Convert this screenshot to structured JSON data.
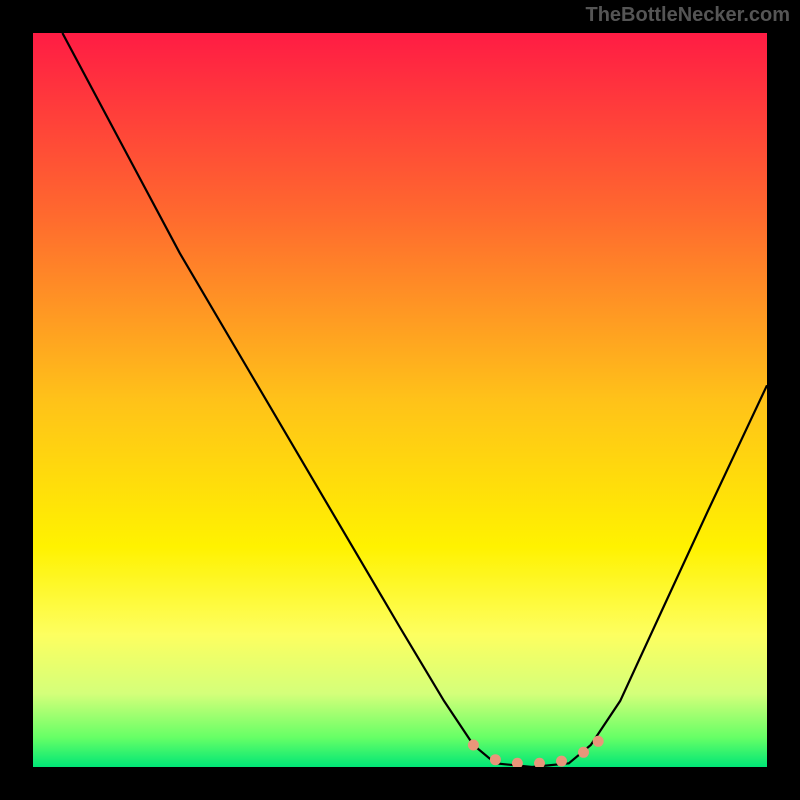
{
  "watermark": "TheBottleNecker.com",
  "chart_data": {
    "type": "line",
    "title": "",
    "xlabel": "",
    "ylabel": "",
    "xlim": [
      0,
      100
    ],
    "ylim": [
      0,
      100
    ],
    "background_gradient": {
      "stops": [
        {
          "offset": 0,
          "color": "#ff1c44"
        },
        {
          "offset": 25,
          "color": "#ff6a2e"
        },
        {
          "offset": 50,
          "color": "#ffc219"
        },
        {
          "offset": 70,
          "color": "#fff200"
        },
        {
          "offset": 82,
          "color": "#fdff60"
        },
        {
          "offset": 90,
          "color": "#d4ff7a"
        },
        {
          "offset": 96,
          "color": "#66ff66"
        },
        {
          "offset": 100,
          "color": "#00e676"
        }
      ]
    },
    "series": [
      {
        "name": "bottleneck-curve",
        "color": "#000000",
        "points": [
          {
            "x": 4,
            "y": 100
          },
          {
            "x": 12,
            "y": 85
          },
          {
            "x": 20,
            "y": 70
          },
          {
            "x": 30,
            "y": 53
          },
          {
            "x": 40,
            "y": 36
          },
          {
            "x": 50,
            "y": 19
          },
          {
            "x": 56,
            "y": 9
          },
          {
            "x": 60,
            "y": 3
          },
          {
            "x": 63,
            "y": 0.5
          },
          {
            "x": 68,
            "y": 0
          },
          {
            "x": 73,
            "y": 0.5
          },
          {
            "x": 76,
            "y": 3
          },
          {
            "x": 80,
            "y": 9
          },
          {
            "x": 86,
            "y": 22
          },
          {
            "x": 92,
            "y": 35
          },
          {
            "x": 100,
            "y": 52
          }
        ]
      }
    ],
    "markers": {
      "name": "optimal-zone",
      "color": "#e9967a",
      "points": [
        {
          "x": 60,
          "y": 3
        },
        {
          "x": 63,
          "y": 1
        },
        {
          "x": 66,
          "y": 0.5
        },
        {
          "x": 69,
          "y": 0.5
        },
        {
          "x": 72,
          "y": 0.8
        },
        {
          "x": 75,
          "y": 2
        },
        {
          "x": 77,
          "y": 3.5
        }
      ]
    }
  }
}
